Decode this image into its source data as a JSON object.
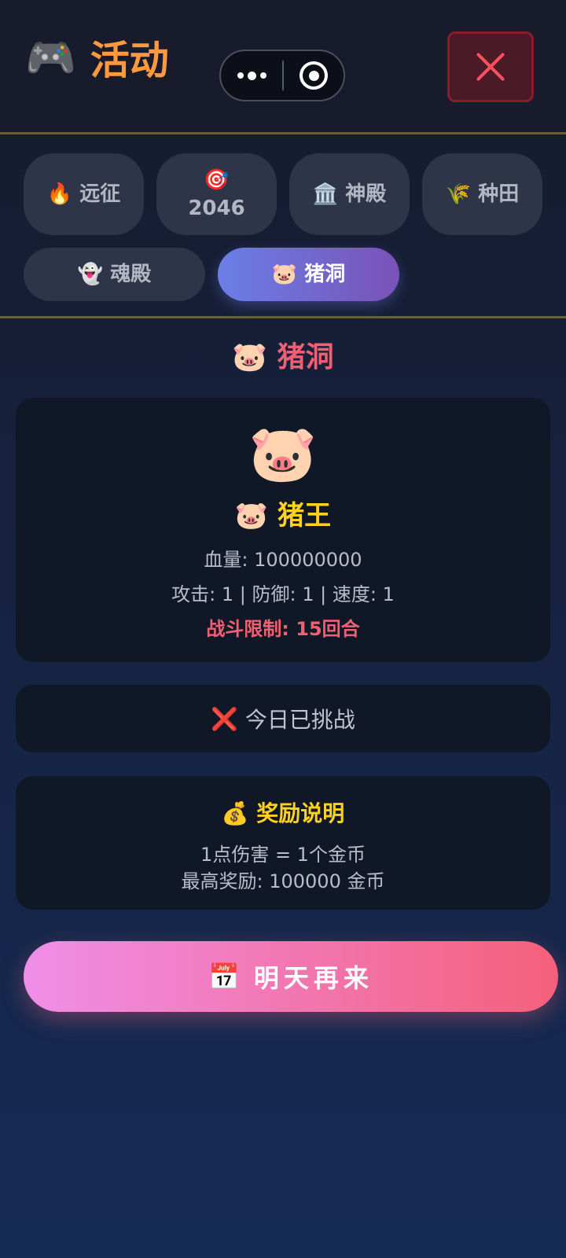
{
  "header": {
    "icon": "🎮",
    "title": "活动",
    "close_icon": "close-icon",
    "accent": "#ff9a3c"
  },
  "tabs": [
    {
      "icon": "🔥",
      "label": "远征",
      "active": false
    },
    {
      "icon": "🎯",
      "label": "2046",
      "active": false
    },
    {
      "icon": "🏛️",
      "label": "神殿",
      "active": false
    },
    {
      "icon": "🌾",
      "label": "种田",
      "active": false
    },
    {
      "icon": "👻",
      "label": "魂殿",
      "active": false
    },
    {
      "icon": "🐷",
      "label": "猪洞",
      "active": true
    }
  ],
  "section": {
    "title": "🐷 猪洞"
  },
  "boss": {
    "avatar": "🐷",
    "name": "🐷 猪王",
    "hp": "血量: 100000000",
    "stats": "攻击: 1 | 防御: 1 | 速度: 1",
    "limit": "战斗限制: 15回合"
  },
  "status": {
    "icon": "❌",
    "text": "今日已挑战"
  },
  "reward": {
    "title": "💰 奖励说明",
    "line1": "1点伤害 = 1个金币",
    "line2": "最高奖励: 100000 金币"
  },
  "cta": {
    "icon": "📅",
    "label": "明天再来"
  },
  "colors": {
    "name_gold": "#ffd21f",
    "danger_red": "#f16072",
    "tab_active_start": "#6a7fe6",
    "tab_active_end": "#7a52b8",
    "cta_start": "#f08ee8",
    "cta_end": "#f4607a"
  }
}
